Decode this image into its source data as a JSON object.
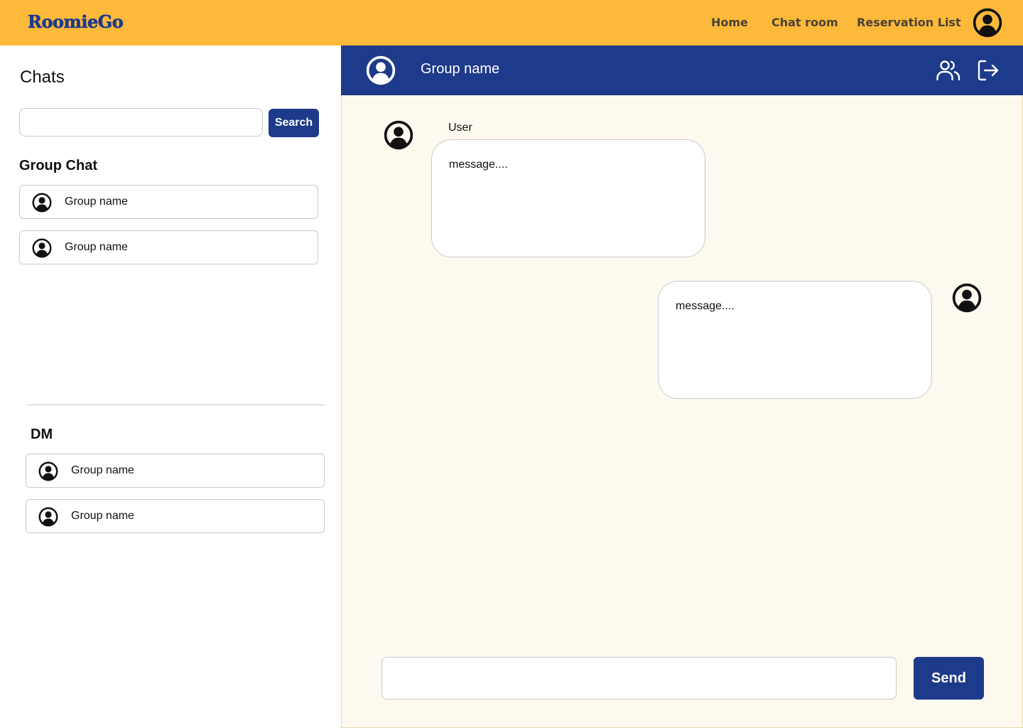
{
  "app": {
    "logo": "RoomieGo"
  },
  "nav": {
    "links": [
      {
        "label": "Home"
      },
      {
        "label": "Chat room"
      },
      {
        "label": "Reservation List"
      }
    ],
    "avatar_icon": "user-circle-icon"
  },
  "sidebar": {
    "title": "Chats",
    "search": {
      "placeholder": "",
      "value": "",
      "button_label": "Search"
    },
    "group_section": {
      "title": "Group Chat",
      "items": [
        {
          "label": "Group name",
          "icon": "user-circle-icon"
        },
        {
          "label": "Group name",
          "icon": "user-circle-icon"
        }
      ]
    },
    "dm_section": {
      "title": "DM",
      "items": [
        {
          "label": "Group name",
          "icon": "user-circle-icon"
        },
        {
          "label": "Group name",
          "icon": "user-circle-icon"
        }
      ]
    }
  },
  "chat": {
    "header": {
      "title": "Group name",
      "avatar_icon": "user-circle-icon",
      "members_icon": "users-icon",
      "leave_icon": "logout-icon"
    },
    "messages": [
      {
        "sender": "User",
        "text": "message....",
        "direction": "incoming"
      },
      {
        "sender": "",
        "text": "message....",
        "direction": "outgoing"
      }
    ],
    "composer": {
      "placeholder": "",
      "value": "",
      "send_label": "Send"
    }
  },
  "colors": {
    "brand_yellow": "#FDB93A",
    "brand_navy": "#1E3A8A",
    "chat_bg": "#FEF9EE"
  }
}
